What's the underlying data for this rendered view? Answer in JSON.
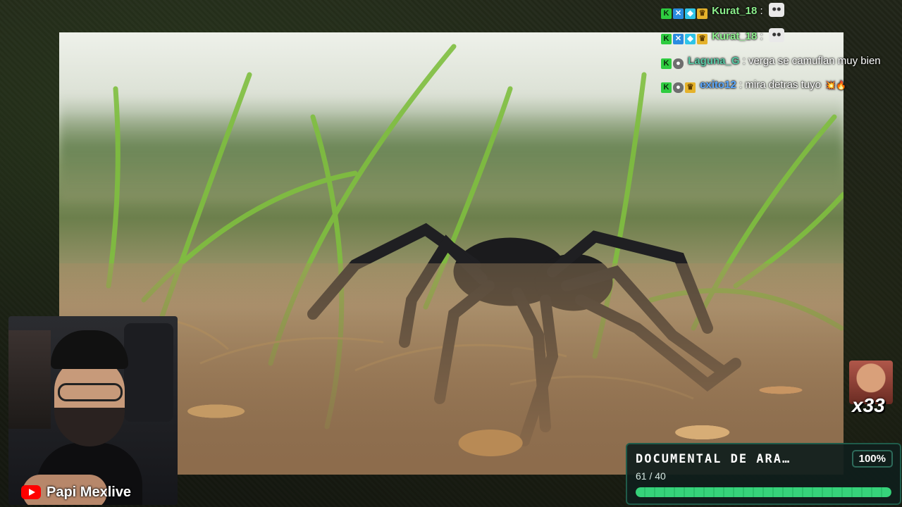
{
  "chat": {
    "messages": [
      {
        "user": "Kurat_18",
        "separator": ":",
        "text": "",
        "badges": [
          "K",
          "blue",
          "cube",
          "crown"
        ],
        "emote": "cat-emote"
      },
      {
        "user": "Kurat_18",
        "separator": ":",
        "text": "",
        "badges": [
          "K",
          "blue",
          "cube",
          "crown"
        ],
        "emote": "cat-emote"
      },
      {
        "user": "Laguna_G",
        "separator": ":",
        "text": "verga se camuflan muy bien",
        "badges": [
          "K",
          "mouse"
        ]
      },
      {
        "user": "exito12",
        "separator": ":",
        "text": "mira detras tuyo",
        "badges": [
          "K",
          "mouse",
          "crown"
        ],
        "trail": "💥🔥"
      }
    ]
  },
  "webcam": {
    "channel_name": "Papi Mexlive"
  },
  "combo": {
    "count": "x33"
  },
  "goal": {
    "title": "DOCUMENTAL DE ARA…",
    "percent": "100%",
    "progress_text": "61 / 40",
    "fill_fraction": 1.0
  },
  "colors": {
    "accent": "#36d27a",
    "user_kurat": "#8cf08c",
    "user_laguna": "#57c8a4",
    "user_exito": "#5aa8ff"
  }
}
